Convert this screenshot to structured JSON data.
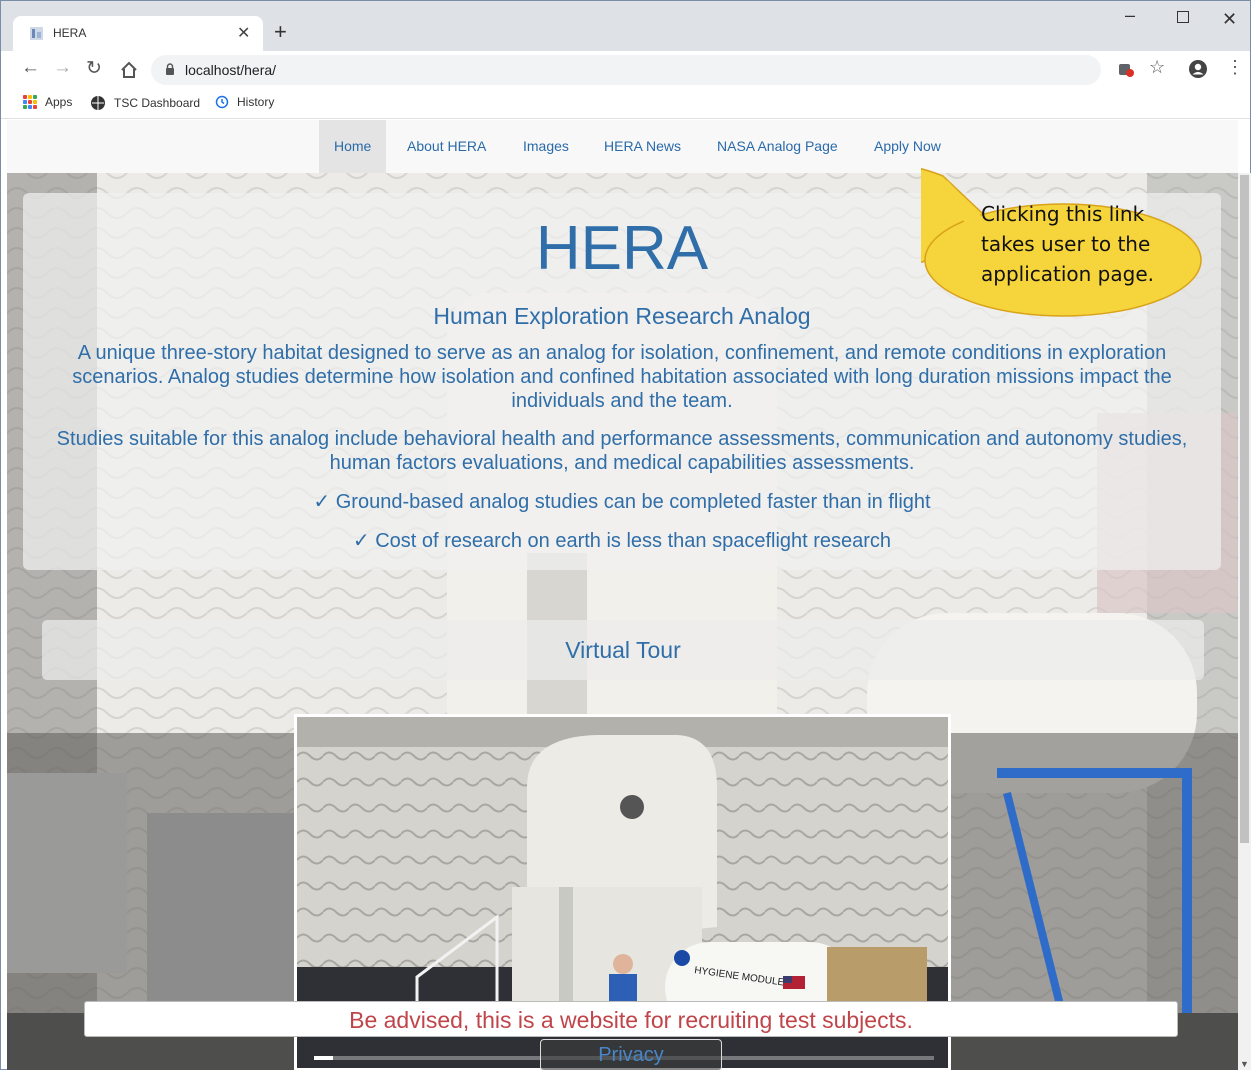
{
  "browser": {
    "tab_title": "HERA",
    "url": "localhost/hera/",
    "bookmarks": [
      "Apps",
      "TSC Dashboard",
      "History"
    ]
  },
  "nav": {
    "items": [
      "Home",
      "About HERA",
      "Images",
      "HERA News",
      "NASA Analog Page",
      "Apply Now"
    ],
    "active": "Home"
  },
  "hero": {
    "title": "HERA",
    "subtitle": "Human Exploration Research Analog",
    "description": "A unique three-story habitat designed to serve as an analog for isolation, confinement, and remote conditions in exploration scenarios. Analog studies determine how isolation and confined habitation associated with long duration missions impact the individuals and the team.",
    "studies": "Studies suitable for this analog include behavioral health and performance assessments, communication and autonomy studies, human factors evaluations, and medical capabilities assessments.",
    "checks": [
      "✓ Ground-based analog studies can be completed faster than in flight",
      "✓ Cost of research on earth is less than spaceflight research"
    ]
  },
  "tour": {
    "label": "Virtual Tour"
  },
  "video": {
    "progress": 0.03
  },
  "advisory": "Be advised, this is a website for recruiting test subjects.",
  "privacy": "Privacy",
  "callout": "Clicking this link takes user to the application page.",
  "colors": {
    "link": "#2a6aa9",
    "advisory": "#c0454a",
    "callout_fill": "#f6d43b"
  }
}
